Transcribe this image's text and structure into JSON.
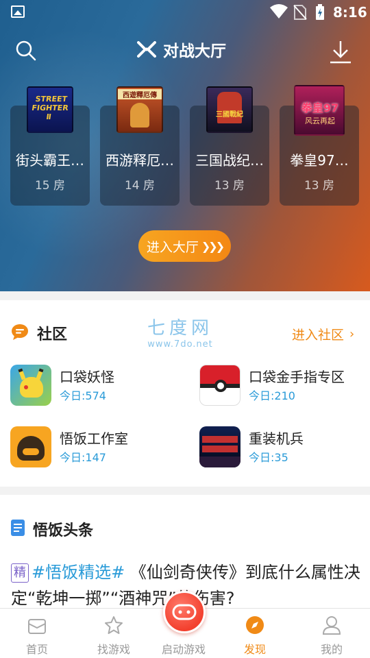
{
  "status_bar": {
    "time": "8:16"
  },
  "header": {
    "title": "对战大厅"
  },
  "games": [
    {
      "name": "街头霸王…",
      "rooms": "15",
      "room_unit": "房",
      "thumb_text": "STREET FIGHTER II"
    },
    {
      "name": "西游释厄…",
      "rooms": "14",
      "room_unit": "房",
      "thumb_text": "西遊釋厄傳"
    },
    {
      "name": "三国战纪…",
      "rooms": "13",
      "room_unit": "房",
      "thumb_text": "三國戰紀"
    },
    {
      "name": "拳皇97…",
      "rooms": "13",
      "room_unit": "房",
      "thumb_text": "拳皇97 风云再起"
    }
  ],
  "enter_hall_label": "进入大厅",
  "community": {
    "title": "社区",
    "watermark": {
      "line1": "七度网",
      "line2": "www.7do.net"
    },
    "enter_label": "进入社区",
    "forums": [
      {
        "name": "口袋妖怪",
        "today": "今日:574"
      },
      {
        "name": "口袋金手指专区",
        "today": "今日:210"
      },
      {
        "name": "悟饭工作室",
        "today": "今日:147"
      },
      {
        "name": "重装机兵",
        "today": "今日:35"
      }
    ]
  },
  "news": {
    "title": "悟饭头条",
    "badge": "精",
    "tag": "#悟饭精选#",
    "text": "《仙剑奇侠传》到底什么属性决定“乾坤一掷”“酒神咒”的伤害?"
  },
  "tabs": [
    {
      "label": "首页",
      "icon": "home-icon"
    },
    {
      "label": "找游戏",
      "icon": "star-icon"
    },
    {
      "label": "启动游戏",
      "icon": "gamepad-icon"
    },
    {
      "label": "发现",
      "icon": "compass-icon",
      "active": true
    },
    {
      "label": "我的",
      "icon": "user-icon"
    }
  ],
  "colors": {
    "accent": "#f08a16",
    "link_blue": "#2a9bd8",
    "launch_red": "#f3402e"
  }
}
